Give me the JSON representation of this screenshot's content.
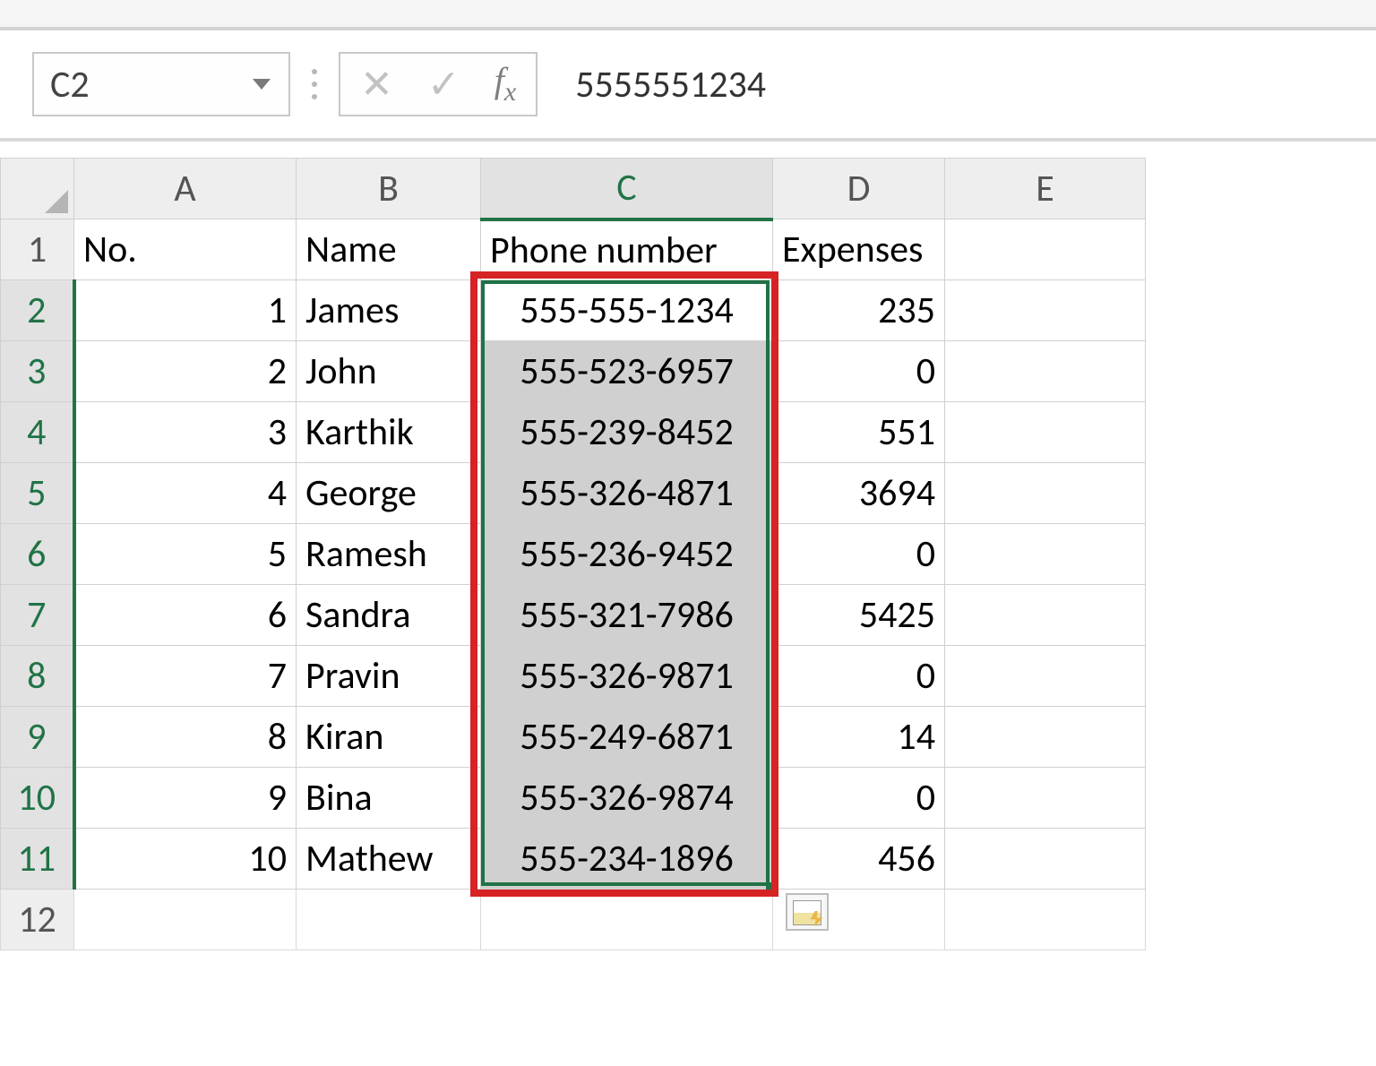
{
  "name_box": {
    "cell_ref": "C2"
  },
  "formula_bar": {
    "value": "5555551234"
  },
  "column_headers": [
    "A",
    "B",
    "C",
    "D",
    "E"
  ],
  "selected_column": "C",
  "selected_rows": [
    2,
    3,
    4,
    5,
    6,
    7,
    8,
    9,
    10,
    11
  ],
  "header_row": {
    "A": "No.",
    "B": "Name",
    "C": "Phone number",
    "D": "Expenses"
  },
  "rows": [
    {
      "no": "1",
      "name": "James",
      "phone": "555-555-1234",
      "expenses": "235"
    },
    {
      "no": "2",
      "name": "John",
      "phone": "555-523-6957",
      "expenses": "0"
    },
    {
      "no": "3",
      "name": "Karthik",
      "phone": "555-239-8452",
      "expenses": "551"
    },
    {
      "no": "4",
      "name": "George",
      "phone": "555-326-4871",
      "expenses": "3694"
    },
    {
      "no": "5",
      "name": "Ramesh",
      "phone": "555-236-9452",
      "expenses": "0"
    },
    {
      "no": "6",
      "name": "Sandra",
      "phone": "555-321-7986",
      "expenses": "5425"
    },
    {
      "no": "7",
      "name": "Pravin",
      "phone": "555-326-9871",
      "expenses": "0"
    },
    {
      "no": "8",
      "name": "Kiran",
      "phone": "555-249-6871",
      "expenses": "14"
    },
    {
      "no": "9",
      "name": "Bina",
      "phone": "555-326-9874",
      "expenses": "0"
    },
    {
      "no": "10",
      "name": "Mathew",
      "phone": "555-234-1896",
      "expenses": "456"
    }
  ],
  "row_numbers": [
    "1",
    "2",
    "3",
    "4",
    "5",
    "6",
    "7",
    "8",
    "9",
    "10",
    "11",
    "12"
  ]
}
